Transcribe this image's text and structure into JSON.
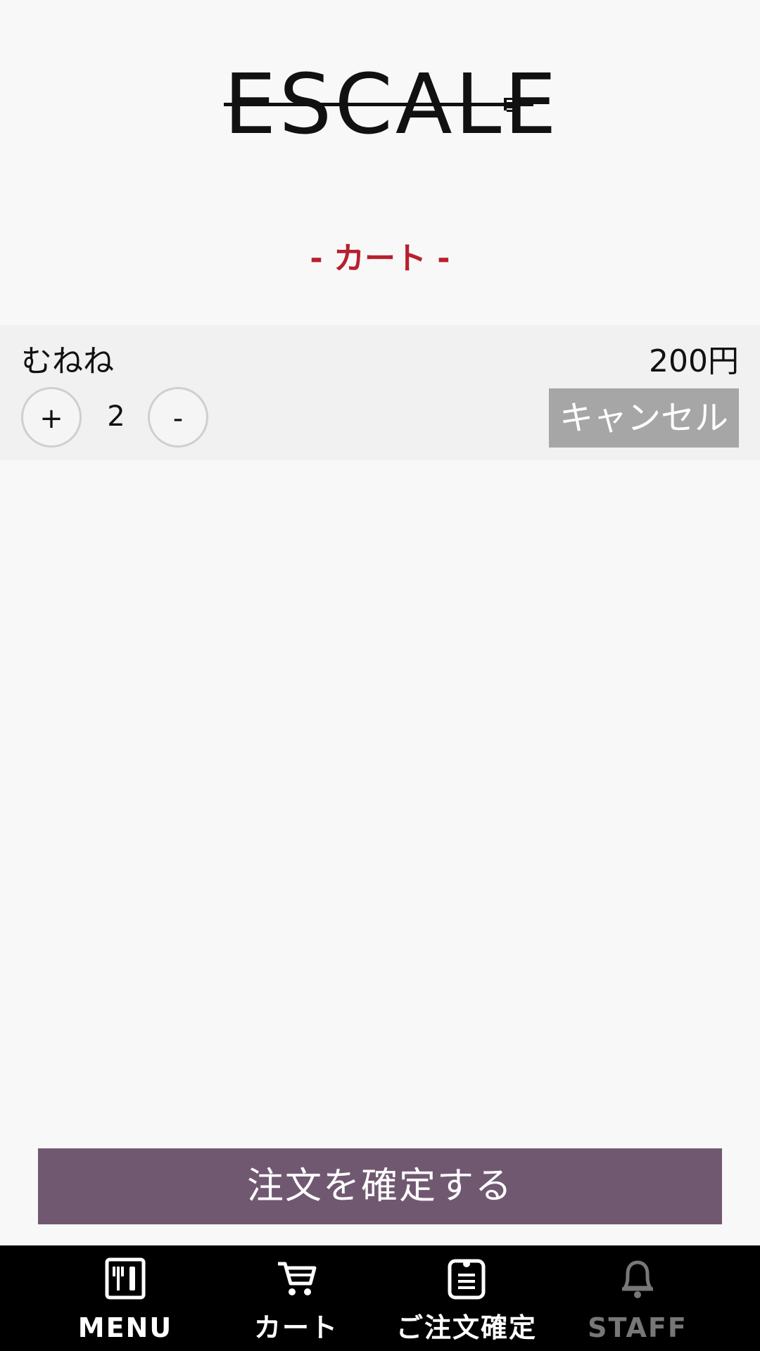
{
  "header": {
    "logo_text": "ESCALE"
  },
  "page": {
    "title": "- カート -"
  },
  "cart": {
    "items": [
      {
        "name": "むねね",
        "price": "200円",
        "quantity": "2",
        "plus_label": "+",
        "minus_label": "-",
        "cancel_label": "キャンセル"
      }
    ]
  },
  "actions": {
    "confirm_label": "注文を確定する"
  },
  "bottom_nav": {
    "items": [
      {
        "label": "MENU",
        "icon": "menu-icon"
      },
      {
        "label": "カート",
        "icon": "cart-icon"
      },
      {
        "label": "ご注文確定",
        "icon": "order-confirm-icon"
      },
      {
        "label": "STAFF",
        "icon": "bell-icon"
      }
    ]
  },
  "colors": {
    "accent_red": "#b7202e",
    "confirm_button": "#715871",
    "cancel_button": "#a6a6a6",
    "nav_background": "#000000"
  }
}
